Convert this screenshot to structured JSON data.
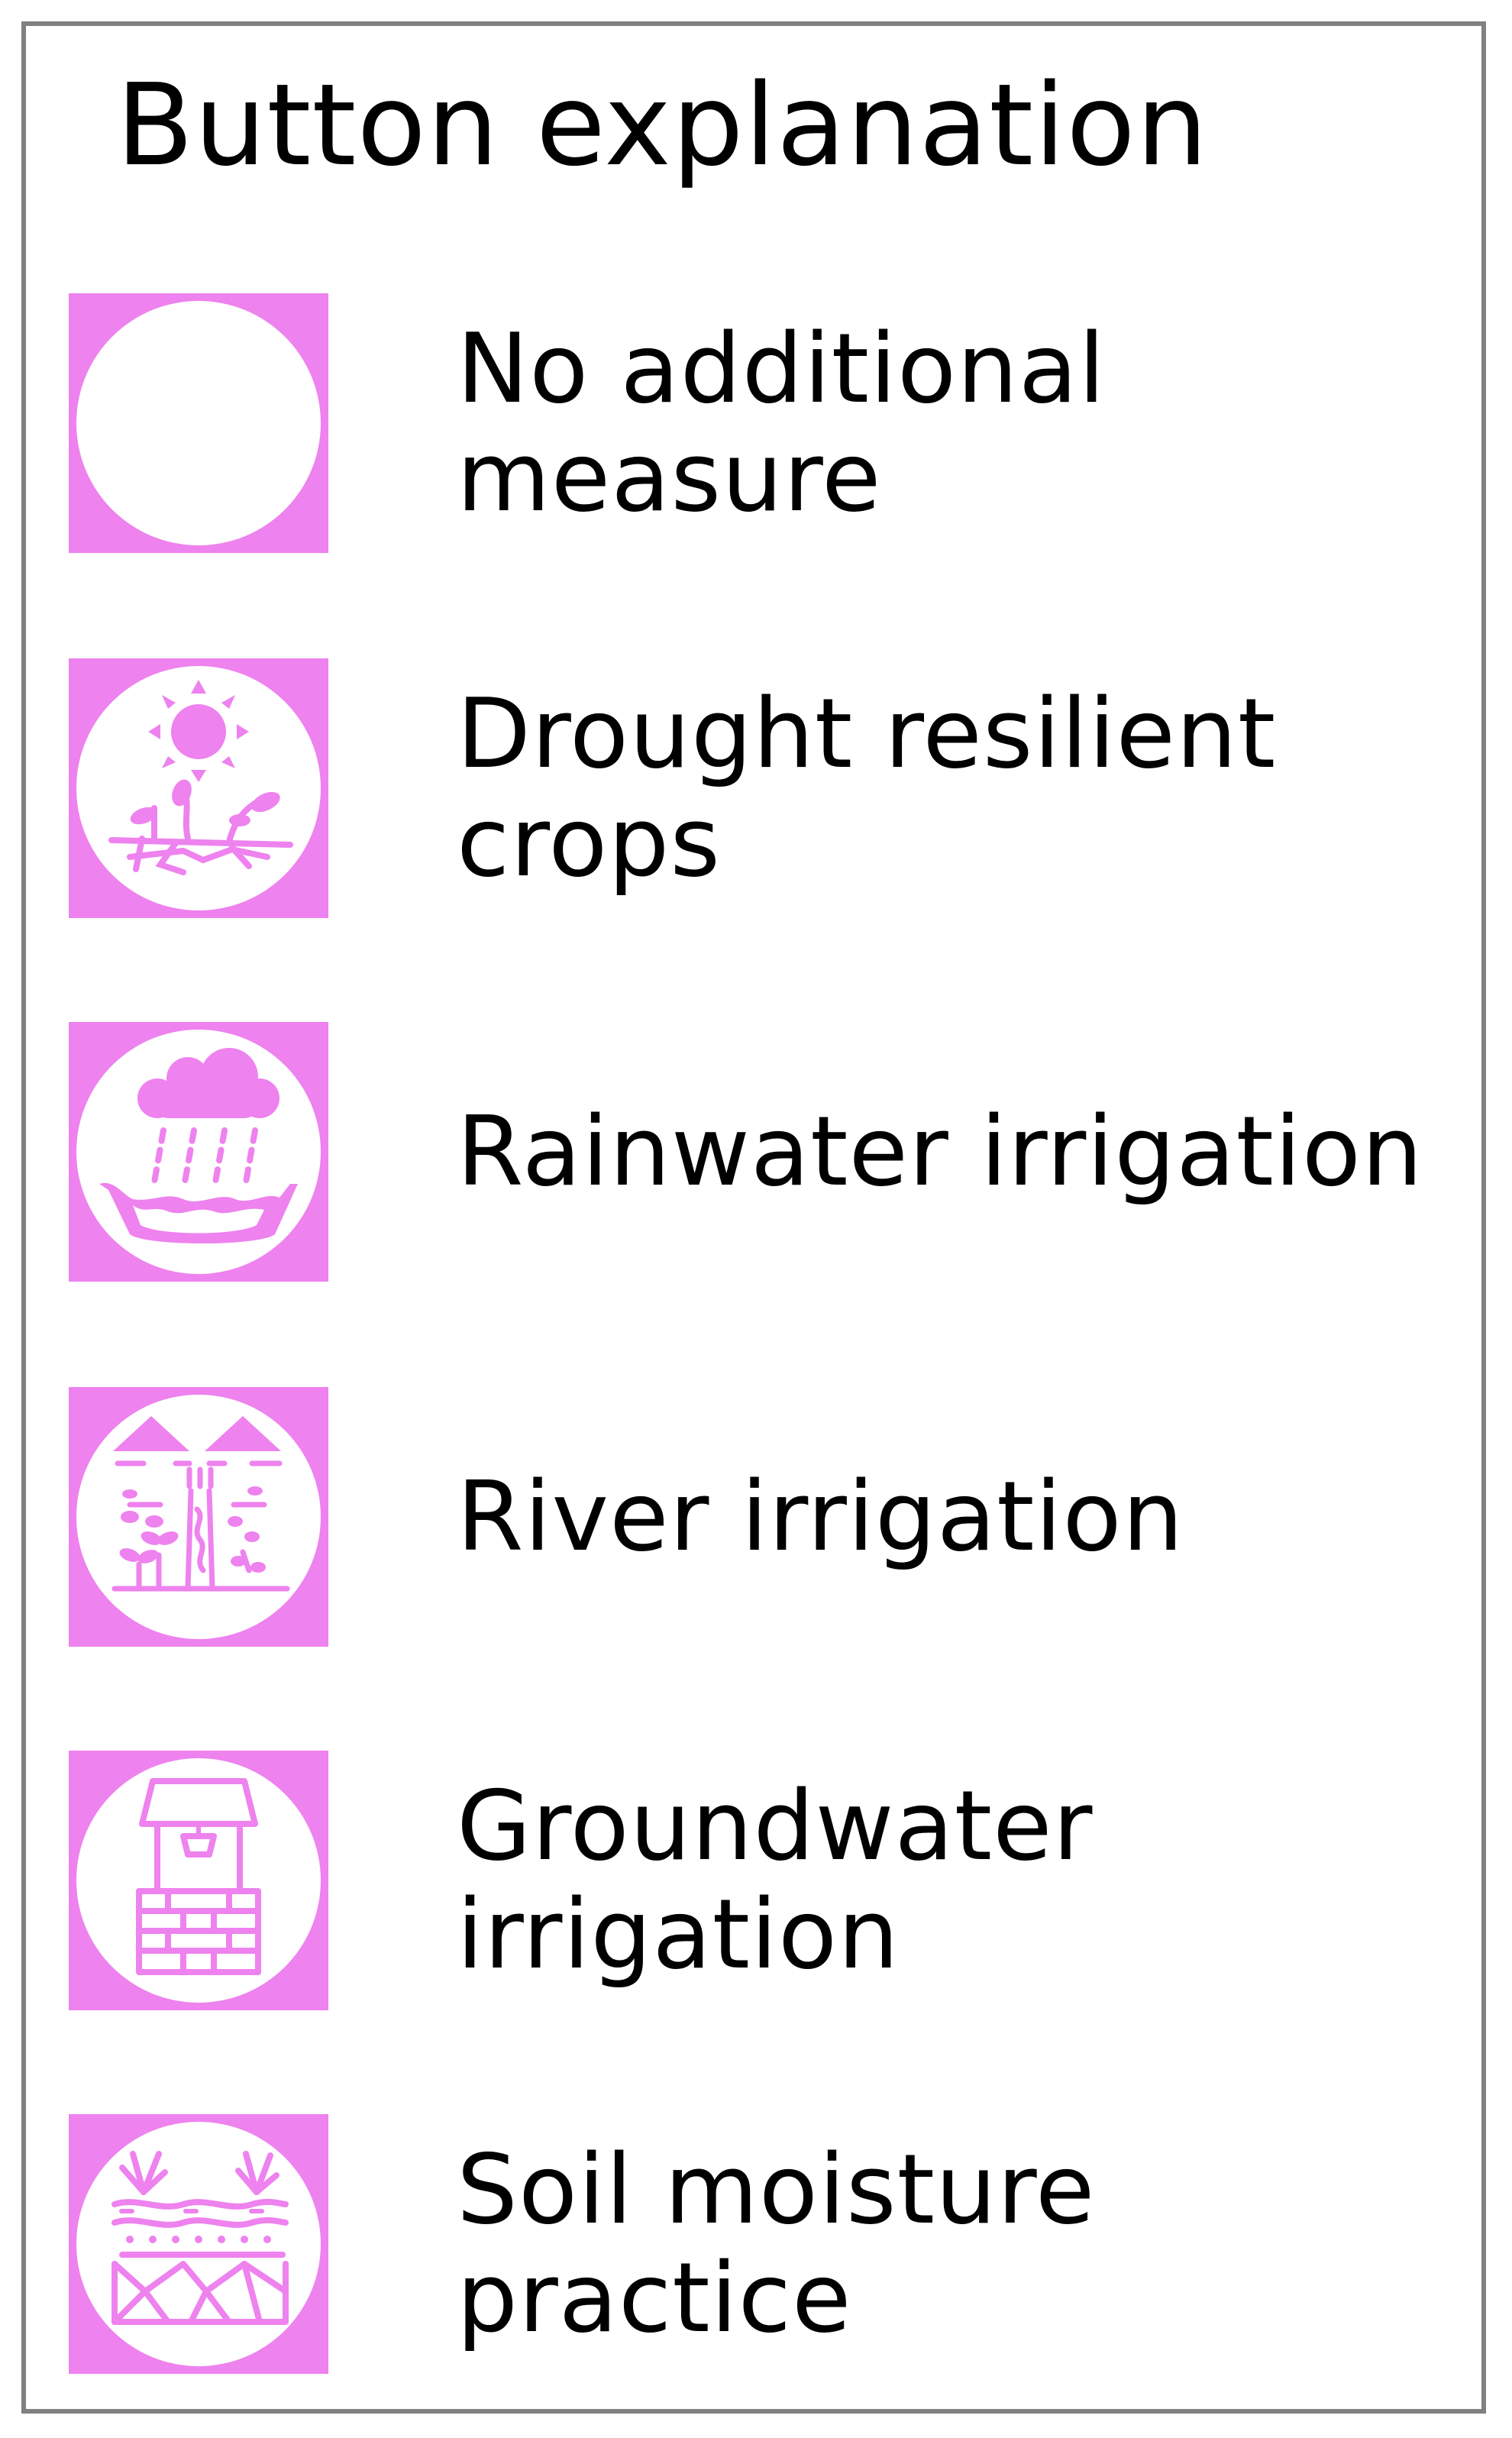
{
  "legend": {
    "title": "Button explanation",
    "accent_color": "#ee82ee",
    "items": [
      {
        "lines": [
          "No additional",
          "measure"
        ],
        "icon": "empty-circle-icon"
      },
      {
        "lines": [
          "Drought resilient",
          "crops"
        ],
        "icon": "sun-dry-crops-icon"
      },
      {
        "lines": [
          "Rainwater irrigation"
        ],
        "icon": "rain-cloud-basin-icon"
      },
      {
        "lines": [
          "River irrigation"
        ],
        "icon": "river-fields-icon"
      },
      {
        "lines": [
          "Groundwater",
          "irrigation"
        ],
        "icon": "water-well-icon"
      },
      {
        "lines": [
          "Soil moisture",
          "practice"
        ],
        "icon": "soil-layers-plants-icon"
      }
    ]
  }
}
